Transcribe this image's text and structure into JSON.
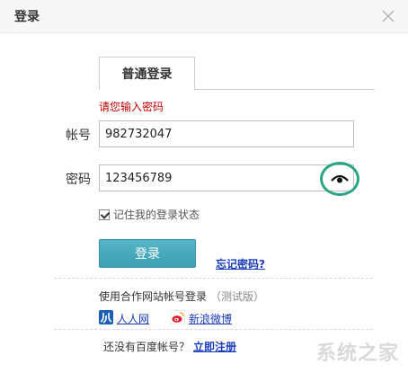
{
  "window": {
    "title": "登录"
  },
  "tabs": [
    {
      "label": "普通登录",
      "active": true
    }
  ],
  "error": {
    "message": "请您输入密码"
  },
  "account": {
    "label": "帐号",
    "value": "982732047"
  },
  "password": {
    "label": "密码",
    "value": "123456789"
  },
  "remember": {
    "label": "记住我的登录状态",
    "checked": true
  },
  "actions": {
    "login_label": "登录",
    "forgot_label": "忘记密码?"
  },
  "partners": {
    "title": "使用合作网站帐号登录",
    "subtitle": "（测试版）",
    "items": [
      {
        "label": "人人网",
        "icon": "renren-icon"
      },
      {
        "label": "新浪微博",
        "icon": "weibo-icon"
      }
    ]
  },
  "register": {
    "prompt": "还没有百度帐号？",
    "link": "立即注册"
  },
  "watermark": {
    "text": "系统之家"
  },
  "colors": {
    "accent": "#3c9fb3",
    "error": "#c00000",
    "link": "#1a3cba",
    "highlight": "#2aa487"
  }
}
